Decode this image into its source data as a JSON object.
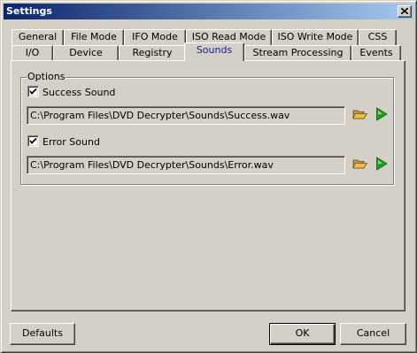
{
  "window": {
    "title": "Settings"
  },
  "tabs_row_back": [
    {
      "label": "General"
    },
    {
      "label": "File Mode"
    },
    {
      "label": "IFO Mode"
    },
    {
      "label": "ISO Read Mode"
    },
    {
      "label": "ISO Write Mode"
    },
    {
      "label": "CSS"
    }
  ],
  "tabs_row_front": [
    {
      "label": "I/O"
    },
    {
      "label": "Device"
    },
    {
      "label": "Registry"
    },
    {
      "label": "Sounds",
      "active": true
    },
    {
      "label": "Stream Processing"
    },
    {
      "label": "Events"
    }
  ],
  "options": {
    "group_label": "Options",
    "success": {
      "label": "Success Sound",
      "checked": true,
      "path": "C:\\Program Files\\DVD Decrypter\\Sounds\\Success.wav"
    },
    "error": {
      "label": "Error Sound",
      "checked": true,
      "path": "C:\\Program Files\\DVD Decrypter\\Sounds\\Error.wav"
    }
  },
  "buttons": {
    "defaults": "Defaults",
    "ok": "OK",
    "cancel": "Cancel"
  },
  "icons": {
    "close": "close-icon",
    "folder": "folder-open-icon",
    "play": "play-icon"
  },
  "colors": {
    "title_start": "#0a246a",
    "title_end": "#a6caf0",
    "active_tab_text": "#1a1a8c",
    "play_green": "#1ea01e",
    "folder_yellow": "#e8c040"
  }
}
